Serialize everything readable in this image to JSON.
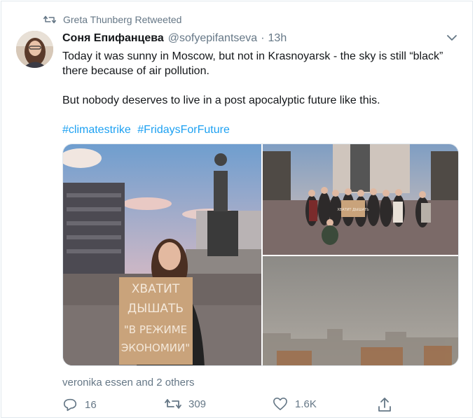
{
  "retweet_banner": {
    "icon": "retweet-icon",
    "text": "Greta Thunberg Retweeted"
  },
  "tweet": {
    "author_name": "Соня Епифанцева",
    "handle": "@sofyepifantseva",
    "separator": "·",
    "time": "13h",
    "paragraphs": [
      "Today it was sunny in Moscow, but not in Krasnoyarsk - the sky is still “black” there because of air pollution.",
      "But nobody deserves to live in a post apocalyptic future like this."
    ],
    "hashtags": [
      "#climatestrike",
      "#FridaysForFuture"
    ],
    "media": {
      "sign_lines": [
        "ХВАТИТ",
        "ДЫШАТЬ",
        "\"В РЕЖИМЕ",
        "ЭКОНОМИИ\""
      ],
      "small_sign": "ХВАТИТ ДЫШАТЬ"
    },
    "liked_by": "veronika essen and 2 others",
    "actions": {
      "reply_count": "16",
      "retweet_count": "309",
      "like_count": "1.6K"
    }
  },
  "colors": {
    "link": "#1da1f2",
    "secondary_text": "#657786",
    "border": "#e1e8ed"
  }
}
